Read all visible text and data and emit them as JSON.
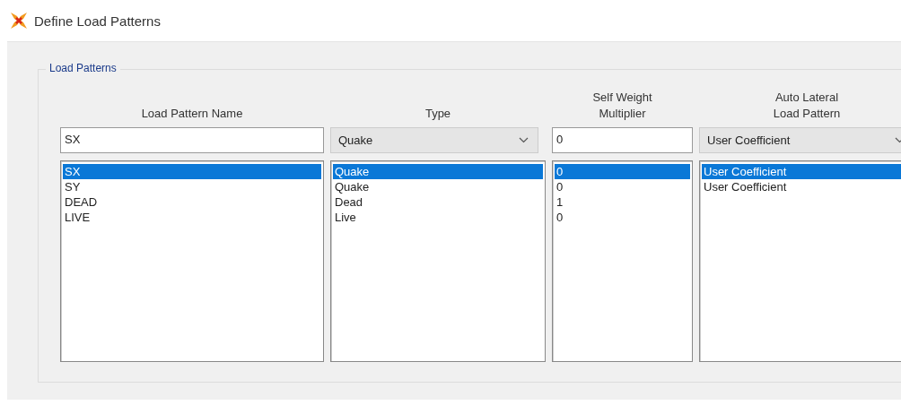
{
  "window": {
    "title": "Define Load Patterns"
  },
  "group": {
    "title": "Load Patterns"
  },
  "columns": [
    {
      "header": "Load Pattern Name",
      "kind": "text",
      "value": "SX"
    },
    {
      "header": "Type",
      "kind": "combo",
      "value": "Quake"
    },
    {
      "header": "Self Weight\nMultiplier",
      "kind": "text",
      "value": "0"
    },
    {
      "header": "Auto Lateral\nLoad Pattern",
      "kind": "combo",
      "value": "User Coefficient"
    }
  ],
  "rows": [
    {
      "cells": [
        "SX",
        "Quake",
        "0",
        "User Coefficient"
      ],
      "selected": true
    },
    {
      "cells": [
        "SY",
        "Quake",
        "0",
        "User Coefficient"
      ],
      "selected": false
    },
    {
      "cells": [
        "DEAD",
        "Dead",
        "1"
      ],
      "selected": false
    },
    {
      "cells": [
        "LIVE",
        "Live",
        "0"
      ],
      "selected": false
    }
  ]
}
